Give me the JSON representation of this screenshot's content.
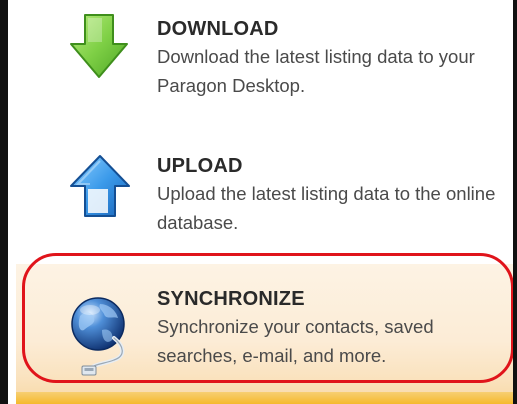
{
  "menu": {
    "items": [
      {
        "id": "download",
        "icon": "download-arrow-icon",
        "title": "DOWNLOAD",
        "description": "Download the latest listing data to your Paragon Desktop.",
        "color": "#6cc23a"
      },
      {
        "id": "upload",
        "icon": "upload-arrow-icon",
        "title": "UPLOAD",
        "description": "Upload the latest listing data to the online database.",
        "color": "#2f86d6"
      },
      {
        "id": "synchronize",
        "icon": "globe-sync-icon",
        "title": "SYNCHRONIZE",
        "description": "Synchronize your contacts, saved searches, e-mail, and more.",
        "highlighted": true,
        "highlight_color": "#e0141b"
      }
    ]
  }
}
